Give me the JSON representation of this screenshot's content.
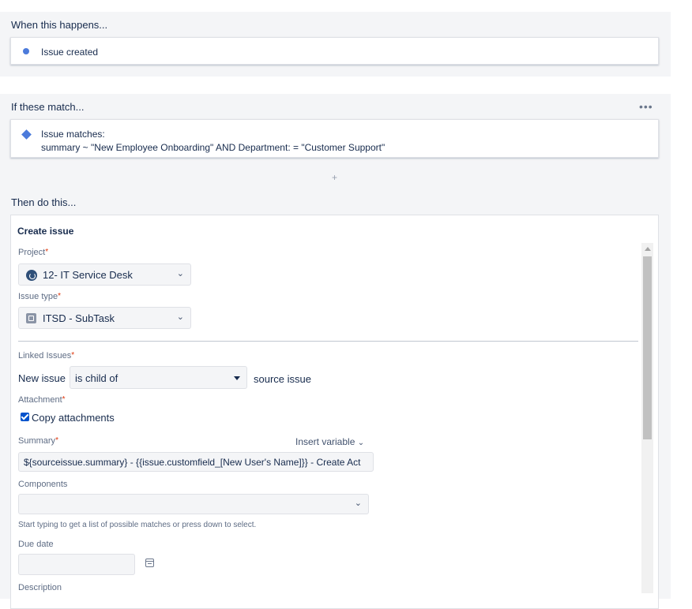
{
  "trigger": {
    "section_title": "When this happens...",
    "item": "Issue created"
  },
  "condition": {
    "section_title": "If these match...",
    "line1": "Issue matches:",
    "line2": "summary ~ \"New Employee Onboarding\" AND Department: = \"Customer Support\"",
    "more_icon": "•••",
    "add_icon": "+"
  },
  "action": {
    "section_title": "Then do this...",
    "card_title": "Create issue",
    "project": {
      "label": "Project",
      "required_mark": "*",
      "value": "12- IT Service Desk",
      "icon": "project-avatar-icon"
    },
    "issue_type": {
      "label": "Issue type",
      "required_mark": "*",
      "value": "ITSD - SubTask",
      "icon": "subtask-icon"
    },
    "linked_issues": {
      "label": "Linked Issues",
      "required_mark": "*",
      "prefix": "New issue",
      "relation": "is child of",
      "suffix": "source issue"
    },
    "attachment": {
      "label": "Attachment",
      "required_mark": "*",
      "checkbox_label": "Copy attachments",
      "checked": true
    },
    "summary": {
      "label": "Summary",
      "required_mark": "*",
      "insert_variable": "Insert variable",
      "value": "${sourceissue.summary} - {{issue.customfield_[New User's Name]}} - Create Act"
    },
    "components": {
      "label": "Components",
      "value": "",
      "help": "Start typing to get a list of possible matches or press down to select."
    },
    "due_date": {
      "label": "Due date",
      "value": ""
    },
    "description": {
      "label": "Description"
    }
  },
  "colors": {
    "accent": "#4c7bdb",
    "required": "#de350b",
    "panel_bg": "#f4f5f7"
  }
}
